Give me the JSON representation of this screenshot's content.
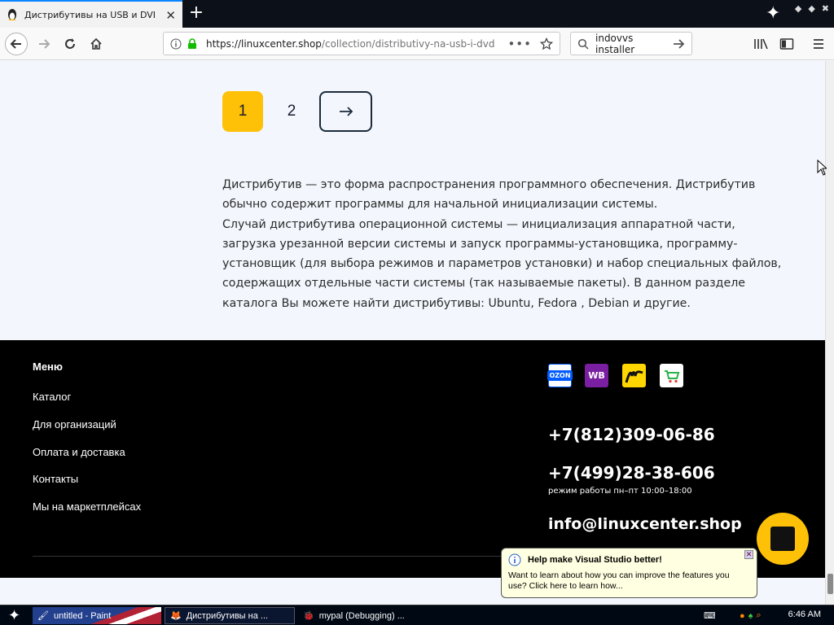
{
  "browser": {
    "tab_title": "Дистрибутивы на USB и DVD по",
    "url_host": "https://linuxcenter.shop",
    "url_path": "/collection/distributivy-na-usb-i-dvd",
    "search_value": "indovvs installer"
  },
  "pagination": {
    "page1": "1",
    "page2": "2"
  },
  "description": {
    "line1": "Дистрибутив — это форма распространения программного обеспечения. Дистрибутив обычно содержит программы для начальной инициализации системы.",
    "line2": "Случай дистрибутива операционной системы — инициализация аппаратной части, загрузка урезанной версии системы и запуск программы-установщика, программу-установщик (для выбора режимов и параметров установки) и набор специальных файлов, содержащих отдельные части системы (так называемые пакеты). В данном разделе каталога Вы можете найти дистрибутивы: Ubuntu, Fedora , Debian и другие."
  },
  "footer": {
    "menu_title": "Меню",
    "menu": [
      "Каталог",
      "Для организаций",
      "Оплата и доставка",
      "Контакты",
      "Мы на маркетплейсах"
    ],
    "marketplaces": [
      "OZON",
      "WB"
    ],
    "phone1": "+7(812)309-06-86",
    "phone2": "+7(499)28-38-606",
    "hours": "режим работы  пн–пт 10:00–18:00",
    "email": "info@linuxcenter.shop"
  },
  "popup": {
    "title": "Help make Visual Studio better!",
    "body": "Want to learn about how you can improve the features you use? Click here to learn how..."
  },
  "taskbar": {
    "tasks": [
      "untitled - Paint",
      "Дистрибутивы на ...",
      "mypal (Debugging) ..."
    ],
    "clock": "6:46 AM"
  },
  "colors": {
    "accent": "#ffc107",
    "footer_bg": "#000000",
    "page_bg": "#f3f7fd"
  }
}
